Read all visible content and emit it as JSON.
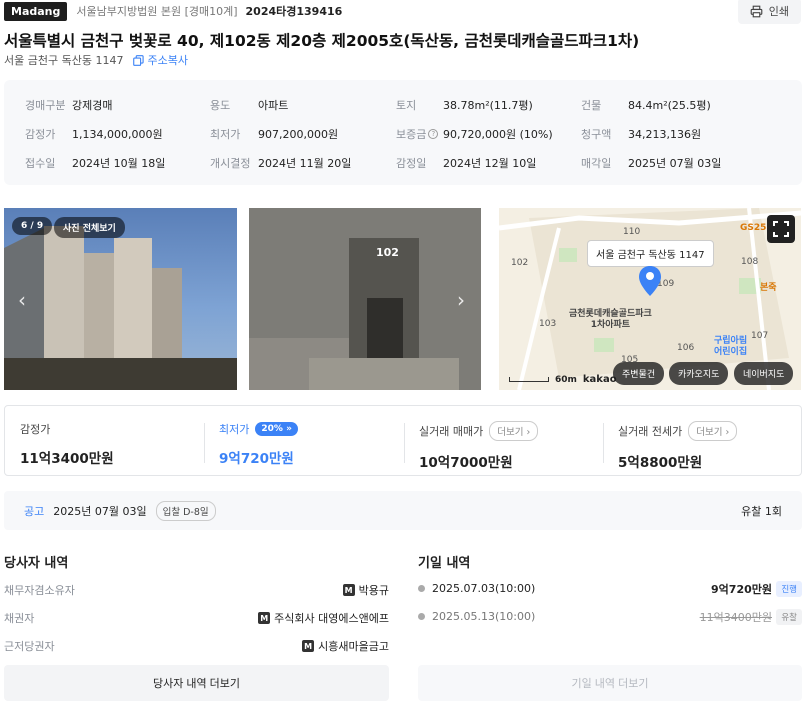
{
  "header": {
    "brand": "Madang",
    "court": "서울남부지방법원 본원 [경매10계]",
    "case_no": "2024타경139416",
    "print_label": "인쇄"
  },
  "title": "서울특별시 금천구 벚꽃로 40, 제102동 제20층 제2005호(독산동, 금천롯데캐슬골드파크1차)",
  "address": {
    "short": "서울 금천구 독산동 1147",
    "copy_label": "주소복사"
  },
  "info": [
    {
      "k": "경매구분",
      "v": "강제경매"
    },
    {
      "k": "용도",
      "v": "아파트"
    },
    {
      "k": "토지",
      "v": "38.78m²(11.7평)"
    },
    {
      "k": "건물",
      "v": "84.4m²(25.5평)"
    },
    {
      "k": "감정가",
      "v": "1,134,000,000원"
    },
    {
      "k": "최저가",
      "v": "907,200,000원"
    },
    {
      "k": "보증금",
      "v": "90,720,000원 (10%)"
    },
    {
      "k": "청구액",
      "v": "34,213,136원"
    },
    {
      "k": "접수일",
      "v": "2024년 10월 18일"
    },
    {
      "k": "개시결정",
      "v": "2024년 11월 20일"
    },
    {
      "k": "감정일",
      "v": "2024년 12월 10일"
    },
    {
      "k": "매각일",
      "v": "2025년 07월 03일"
    }
  ],
  "photos": {
    "counter": "6 / 9",
    "view_all": "사진 전체보기",
    "building_sign": "102"
  },
  "map": {
    "tooltip": "서울 금천구 독산동 1147",
    "complex_name": "금천롯데캐슬골드파크\n1차아파트",
    "labels": [
      "110",
      "102",
      "109",
      "108",
      "103",
      "107",
      "105",
      "106",
      "GS25",
      "본죽",
      "구립아림\n어린이집"
    ],
    "scale": "60m",
    "provider": "kakao",
    "buttons": [
      "주변물건",
      "카카오지도",
      "네이버지도"
    ]
  },
  "prices": {
    "appraisal": {
      "label": "감정가",
      "value": "11억3400만원"
    },
    "minimum": {
      "label": "최저가",
      "value": "9억720만원",
      "badge": "20%"
    },
    "trade": {
      "label": "실거래 매매가",
      "value": "10억7000만원",
      "more": "더보기"
    },
    "jeonse": {
      "label": "실거래 전세가",
      "value": "5억8800만원",
      "more": "더보기"
    }
  },
  "notice": {
    "label": "공고",
    "date": "2025년 07월 03일",
    "dday": "입찰 D-8일",
    "fail": "유찰 1회"
  },
  "parties": {
    "title": "당사자 내역",
    "rows": [
      {
        "k": "채무자겸소유자",
        "v": "박용규"
      },
      {
        "k": "채권자",
        "v": "주식회사 대영에스앤에프"
      },
      {
        "k": "근저당권자",
        "v": "시흥새마을금고"
      }
    ],
    "more_button": "당사자 내역 더보기"
  },
  "history": {
    "title": "기일 내역",
    "rows": [
      {
        "date": "2025.07.03(10:00)",
        "price": "9억720만원",
        "status": "진행"
      },
      {
        "date": "2025.05.13(10:00)",
        "price": "11억3400만원",
        "status": "유찰"
      }
    ],
    "more_button": "기일 내역 더보기"
  },
  "colors": {
    "accent": "#3b82f6",
    "map_pin": "#3b82f6",
    "muted": "#8a8f98"
  }
}
